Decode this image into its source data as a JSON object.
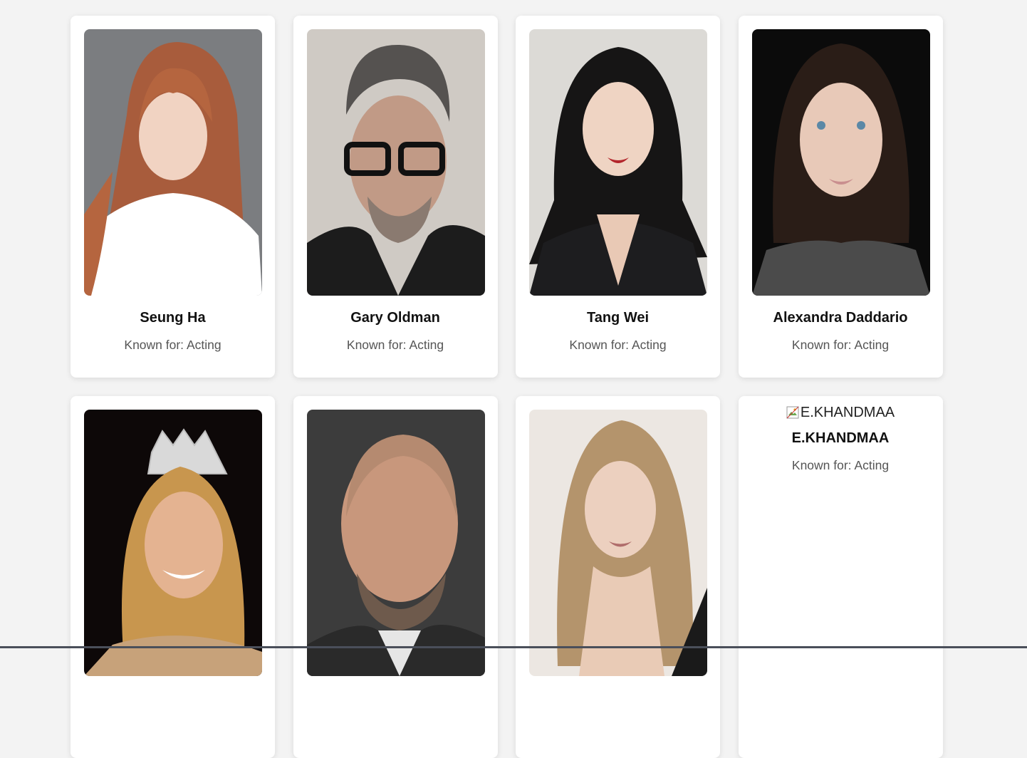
{
  "people": [
    {
      "name": "Seung Ha",
      "known_for": "Known for: Acting",
      "portrait": "portrait-photo"
    },
    {
      "name": "Gary Oldman",
      "known_for": "Known for: Acting",
      "portrait": "portrait-photo"
    },
    {
      "name": "Tang Wei",
      "known_for": "Known for: Acting",
      "portrait": "portrait-photo"
    },
    {
      "name": "Alexandra Daddario",
      "known_for": "Known for: Acting",
      "portrait": "portrait-photo"
    },
    {
      "name": "",
      "known_for": "",
      "portrait": "portrait-photo"
    },
    {
      "name": "",
      "known_for": "",
      "portrait": "portrait-photo"
    },
    {
      "name": "",
      "known_for": "",
      "portrait": "portrait-photo"
    },
    {
      "name": "E.KHANDMAA",
      "known_for": "Known for: Acting",
      "image_alt": "E.KHANDMAA",
      "portrait": "broken-image-icon"
    }
  ],
  "colors": {
    "page_background": "#f3f3f3",
    "card_background": "#ffffff",
    "name_text": "#111111",
    "secondary_text": "#555555"
  }
}
